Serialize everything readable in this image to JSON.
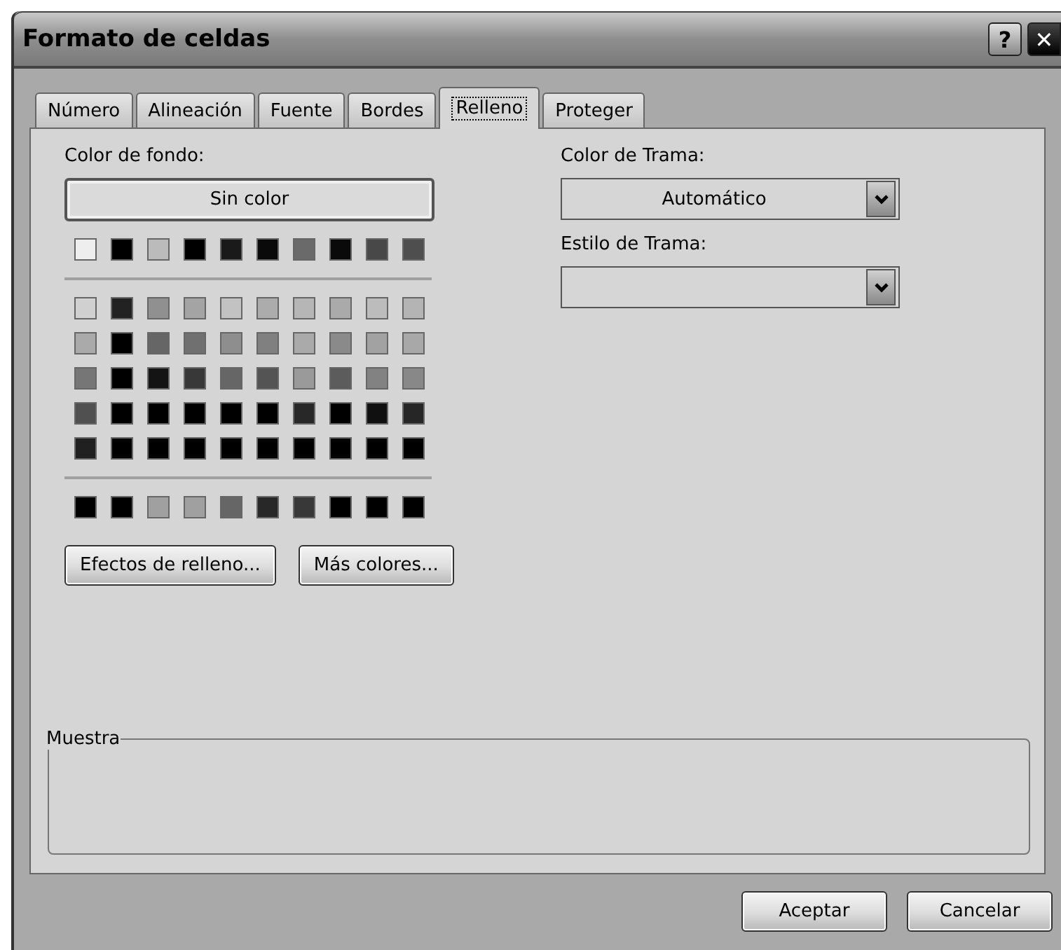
{
  "window": {
    "title": "Formato de celdas",
    "help_button": "?",
    "close_button": "✕"
  },
  "tabs": [
    {
      "label": "Número",
      "selected": false
    },
    {
      "label": "Alineación",
      "selected": false
    },
    {
      "label": "Fuente",
      "selected": false
    },
    {
      "label": "Bordes",
      "selected": false
    },
    {
      "label": "Relleno",
      "selected": true
    },
    {
      "label": "Proteger",
      "selected": false
    }
  ],
  "background_color": {
    "label": "Color de fondo:",
    "no_color_button": "Sin color",
    "theme_row": [
      {
        "color": "#eeeeee"
      },
      {
        "color": "#000000"
      },
      {
        "color": "#bbbbbb"
      },
      {
        "color": "#000000"
      },
      {
        "color": "#1a1a1a"
      },
      {
        "color": "#0a0a0a"
      },
      {
        "color": "#6a6a6a"
      },
      {
        "color": "#0a0a0a"
      },
      {
        "color": "#484848"
      },
      {
        "color": "#4e4e4e"
      }
    ],
    "tint_rows": [
      [
        {
          "color": "#d0d0d0"
        },
        {
          "color": "#222222"
        },
        {
          "color": "#909090"
        },
        {
          "color": "#a4a4a4"
        },
        {
          "color": "#c2c2c2"
        },
        {
          "color": "#acacac"
        },
        {
          "color": "#b6b6b6"
        },
        {
          "color": "#aaaaaa"
        },
        {
          "color": "#bcbcbc"
        },
        {
          "color": "#b4b4b4"
        }
      ],
      [
        {
          "color": "#aaaaaa"
        },
        {
          "color": "#000000"
        },
        {
          "color": "#666666"
        },
        {
          "color": "#707070"
        },
        {
          "color": "#8e8e8e"
        },
        {
          "color": "#808080"
        },
        {
          "color": "#aaaaaa"
        },
        {
          "color": "#8a8a8a"
        },
        {
          "color": "#a2a2a2"
        },
        {
          "color": "#a8a8a8"
        }
      ],
      [
        {
          "color": "#767676"
        },
        {
          "color": "#000000"
        },
        {
          "color": "#141414"
        },
        {
          "color": "#383838"
        },
        {
          "color": "#666666"
        },
        {
          "color": "#545454"
        },
        {
          "color": "#9a9a9a"
        },
        {
          "color": "#5c5c5c"
        },
        {
          "color": "#828282"
        },
        {
          "color": "#888888"
        }
      ],
      [
        {
          "color": "#505050"
        },
        {
          "color": "#000000"
        },
        {
          "color": "#000000"
        },
        {
          "color": "#000000"
        },
        {
          "color": "#000000"
        },
        {
          "color": "#000000"
        },
        {
          "color": "#282828"
        },
        {
          "color": "#000000"
        },
        {
          "color": "#101010"
        },
        {
          "color": "#262626"
        }
      ],
      [
        {
          "color": "#202020"
        },
        {
          "color": "#000000"
        },
        {
          "color": "#000000"
        },
        {
          "color": "#000000"
        },
        {
          "color": "#000000"
        },
        {
          "color": "#000000"
        },
        {
          "color": "#000000"
        },
        {
          "color": "#000000"
        },
        {
          "color": "#000000"
        },
        {
          "color": "#000000"
        }
      ]
    ],
    "standard_row": [
      {
        "color": "#000000"
      },
      {
        "color": "#000000"
      },
      {
        "color": "#a0a0a0"
      },
      {
        "color": "#a0a0a0"
      },
      {
        "color": "#666666"
      },
      {
        "color": "#282828"
      },
      {
        "color": "#383838"
      },
      {
        "color": "#000000"
      },
      {
        "color": "#000000"
      },
      {
        "color": "#000000"
      }
    ],
    "buttons": [
      "Efectos de relleno...",
      "Más colores..."
    ]
  },
  "pattern": {
    "color_label": "Color de Trama:",
    "color_value": "Automático",
    "style_label": "Estilo de Trama:"
  },
  "sample": {
    "label": "Muestra"
  },
  "footer_buttons": [
    "Aceptar",
    "Cancelar"
  ]
}
